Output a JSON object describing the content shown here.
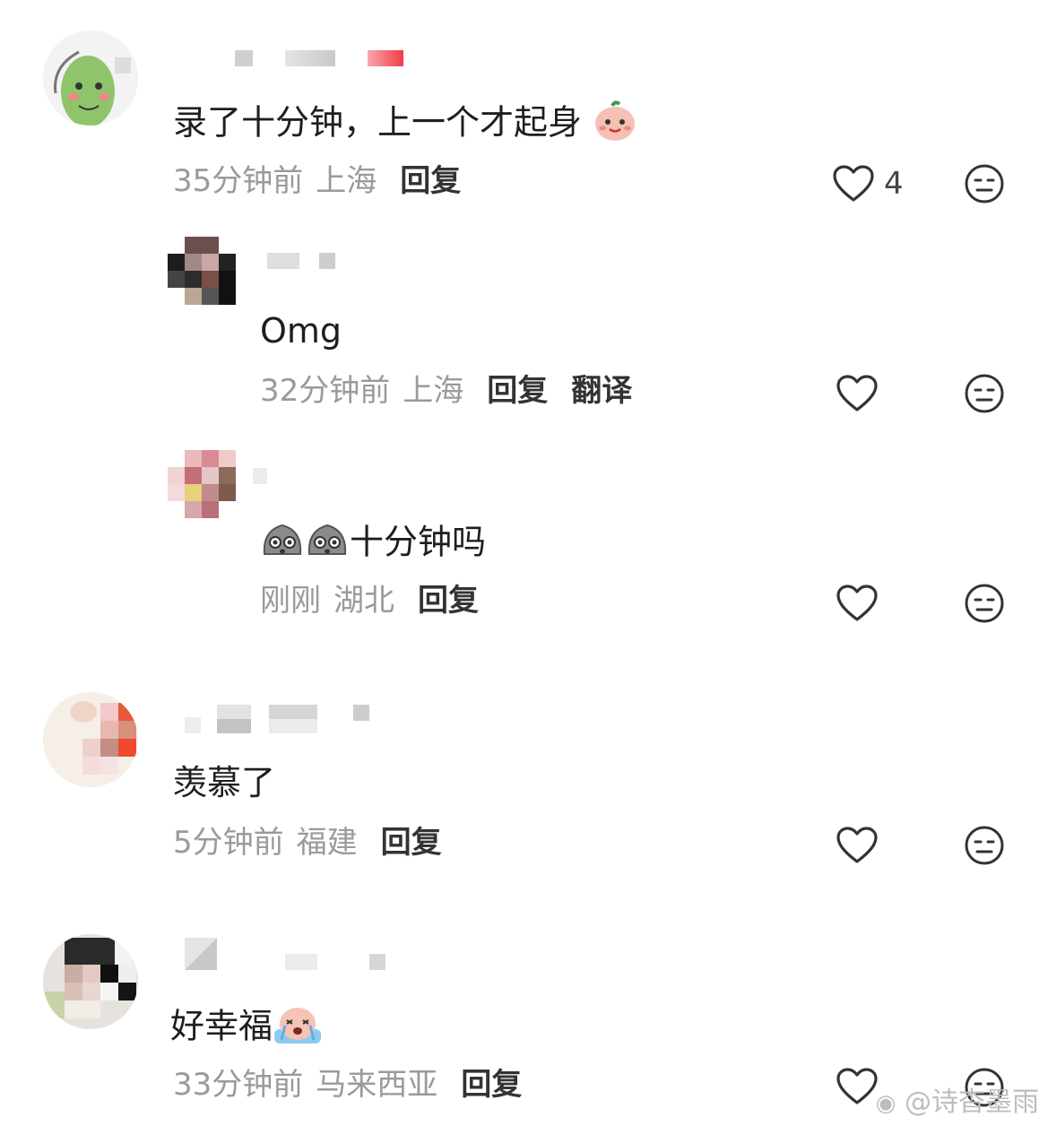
{
  "comments": [
    {
      "text": "录了十分钟，上一个才起身",
      "time": "35分钟前",
      "location": "上海",
      "reply_label": "回复",
      "likes": "4"
    },
    {
      "text": "Omg",
      "time": "32分钟前",
      "location": "上海",
      "reply_label": "回复",
      "translate_label": "翻译"
    },
    {
      "text": "十分钟吗",
      "time": "刚刚",
      "location": "湖北",
      "reply_label": "回复"
    },
    {
      "text": "羡慕了",
      "time": "5分钟前",
      "location": "福建",
      "reply_label": "回复"
    },
    {
      "text": "好幸福",
      "time": "33分钟前",
      "location": "马来西亚",
      "reply_label": "回复"
    }
  ],
  "watermark": "@诗杳墨雨",
  "colors": {
    "meta": "#9a9a9a",
    "text": "#1e1e1e",
    "icon": "#333333"
  },
  "icons": [
    "heart-outline-icon",
    "dislike-face-icon",
    "peach-emoji",
    "rock-face-emoji",
    "crying-emoji"
  ]
}
